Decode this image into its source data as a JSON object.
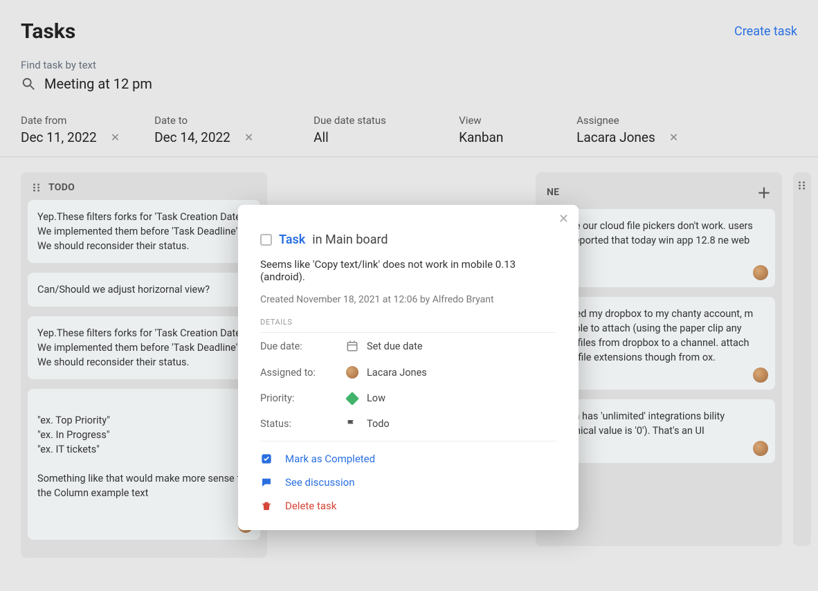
{
  "header": {
    "title": "Tasks",
    "create_link": "Create task"
  },
  "search": {
    "label": "Find task by text",
    "value": "Meeting at 12 pm"
  },
  "filters": {
    "date_from": {
      "label": "Date from",
      "value": "Dec 11, 2022"
    },
    "date_to": {
      "label": "Date to",
      "value": "Dec 14, 2022"
    },
    "due_status": {
      "label": "Due date status",
      "value": "All"
    },
    "view": {
      "label": "View",
      "value": "Kanban"
    },
    "assignee": {
      "label": "Assignee",
      "value": "Lacara Jones"
    }
  },
  "columns": [
    {
      "title": "TODO",
      "cards": [
        {
          "text": "Yep.These filters forks for 'Task Creation Date'. We implemented them before 'Task Deadline'. We should reconsider their status."
        },
        {
          "text": "Can/Should we adjust horizornal view?"
        },
        {
          "text": "Yep.These filters forks for 'Task Creation Date'. We implemented them before 'Task Deadline'. We should reconsider their status."
        },
        {
          "text": "\"ex. Top Priority\"\n\"ex. In Progress\"\n\"ex. IT tickets\"\n\nSomething like that would make more sense for the Column example text",
          "has_avatar": true
        }
      ]
    },
    {
      "title_partial": "NE",
      "cards": [
        {
          "text": "ks like our cloud file pickers don't work. users has reported that today win app 12.8 ne web one",
          "has_avatar": true
        },
        {
          "text": "e linked my dropbox to my chanty account, m not able to attach (using the paper clip any .mp4 files from dropbox to a channel. attach other file extensions though from ox.",
          "has_avatar": true
        },
        {
          "text": "o plan has 'unlimited' integrations bility (technical value is '0'). That's an UI",
          "has_avatar": true
        }
      ]
    }
  ],
  "modal": {
    "task_label": "Task",
    "location": "in Main board",
    "description": "Seems like 'Copy text/link' does not work in mobile 0.13 (android).",
    "created_meta": "Created November 18, 2021 at 12:06 by Alfredo Bryant",
    "details_heading": "DETAILS",
    "details": {
      "due_date": {
        "key": "Due date:",
        "value": "Set due date"
      },
      "assigned": {
        "key": "Assigned to:",
        "value": "Lacara Jones"
      },
      "priority": {
        "key": "Priority:",
        "value": "Low"
      },
      "status": {
        "key": "Status:",
        "value": "Todo"
      }
    },
    "actions": {
      "complete": "Mark as Completed",
      "discuss": "See discussion",
      "delete": "Delete task"
    }
  }
}
